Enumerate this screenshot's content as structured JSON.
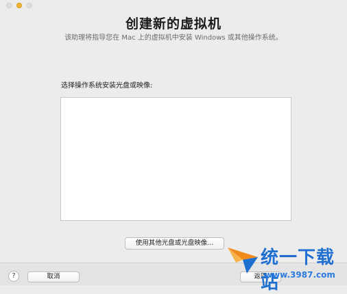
{
  "window": {
    "title": "创建新的虚拟机",
    "subtitle": "该助理将指导您在 Mac 上的虚拟机中安装 Windows 或其他操作系统。"
  },
  "main": {
    "list_label": "选择操作系统安装光盘或映像:",
    "other_disk_button": "使用其他光盘或光盘映像..."
  },
  "footer": {
    "help_label": "?",
    "cancel_label": "取消",
    "back_label": "返回"
  },
  "watermark": {
    "brand": "统一下载站",
    "url": "www.3987.com"
  },
  "colors": {
    "window_bg": "#ececec",
    "list_bg": "#ffffff",
    "traffic_minimize": "#f2b530",
    "watermark_blue": "#1f6fd1",
    "watermark_orange": "#f08a1c"
  }
}
